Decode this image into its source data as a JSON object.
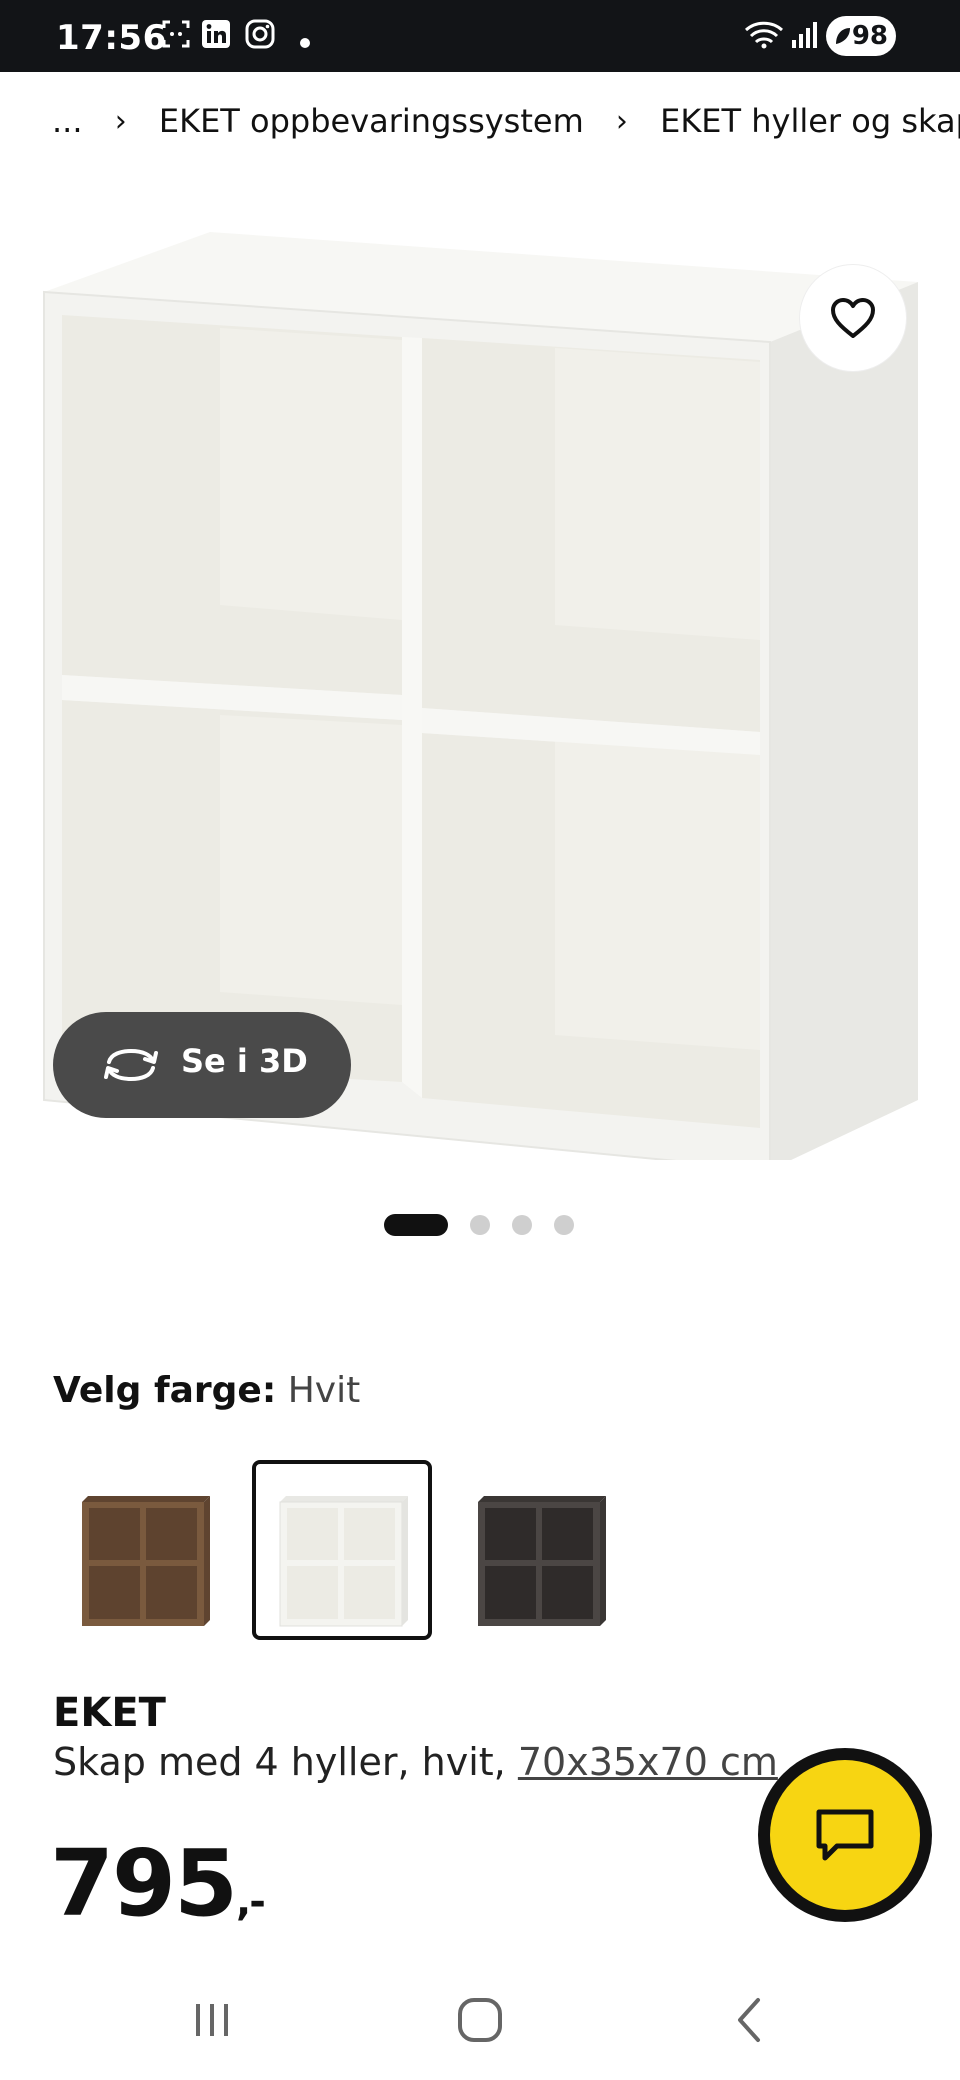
{
  "status_bar": {
    "time": "17:56",
    "battery": "98",
    "icons": [
      "screenshot-icon",
      "linkedin-icon",
      "instagram-icon",
      "notification-dot",
      "wifi-icon",
      "signal-icon",
      "battery-saver-icon"
    ]
  },
  "breadcrumb": {
    "ellipsis": "...",
    "separator": "›",
    "items": [
      "EKET oppbevaringssystem",
      "EKET hyller og skap"
    ]
  },
  "gallery": {
    "view_3d_label": "Se i 3D",
    "image_count": 4,
    "active_index": 0
  },
  "color_selector": {
    "label": "Velg farge:",
    "selected": "Hvit",
    "swatches": [
      {
        "name": "walnut",
        "color": "#7a5a3e"
      },
      {
        "name": "white",
        "color": "#f4f4f0",
        "selected": true
      },
      {
        "name": "dark-grey",
        "color": "#4b4644"
      }
    ]
  },
  "product": {
    "name": "EKET",
    "description": "Skap med 4 hyller, hvit,",
    "size_link": "70x35x70 cm",
    "price": "795",
    "price_suffix": ",-"
  },
  "colors": {
    "accent_yellow": "#f7d512",
    "statusbar_bg": "#121417",
    "view3d_bg": "#4a4a4a"
  }
}
